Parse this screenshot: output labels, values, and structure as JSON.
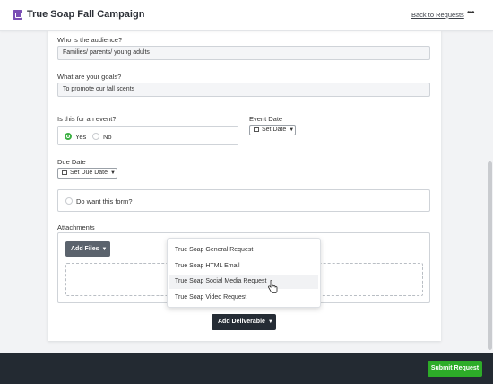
{
  "header": {
    "title": "True Soap Fall Campaign",
    "back_link": "Back to Requests",
    "more_icon": "•••"
  },
  "form": {
    "audience": {
      "label": "Who is the audience?",
      "value": "Families/ parents/ young adults"
    },
    "goals": {
      "label": "What are your goals?",
      "value": "To promote our fall scents"
    },
    "event": {
      "label": "Is this for an event?",
      "options": [
        "Yes",
        "No"
      ],
      "selected": "Yes"
    },
    "event_date": {
      "label": "Event Date",
      "button": "Set Date"
    },
    "due_date": {
      "label": "Due Date",
      "button": "Set Due Date"
    },
    "want_form": {
      "label": "Do want this form?"
    },
    "attachments": {
      "label": "Attachments",
      "add_files": "Add Files"
    }
  },
  "deliverable_menu": {
    "items": [
      "True Soap General Request",
      "True Soap HTML Email",
      "True Soap Social Media Request",
      "True Soap Video Request"
    ],
    "hovered_index": 2
  },
  "add_deliverable": "Add Deliverable",
  "submit": "Submit Request",
  "colors": {
    "accent_green": "#2dac28",
    "footer": "#232a32",
    "app_icon": "#7b4fb5"
  }
}
